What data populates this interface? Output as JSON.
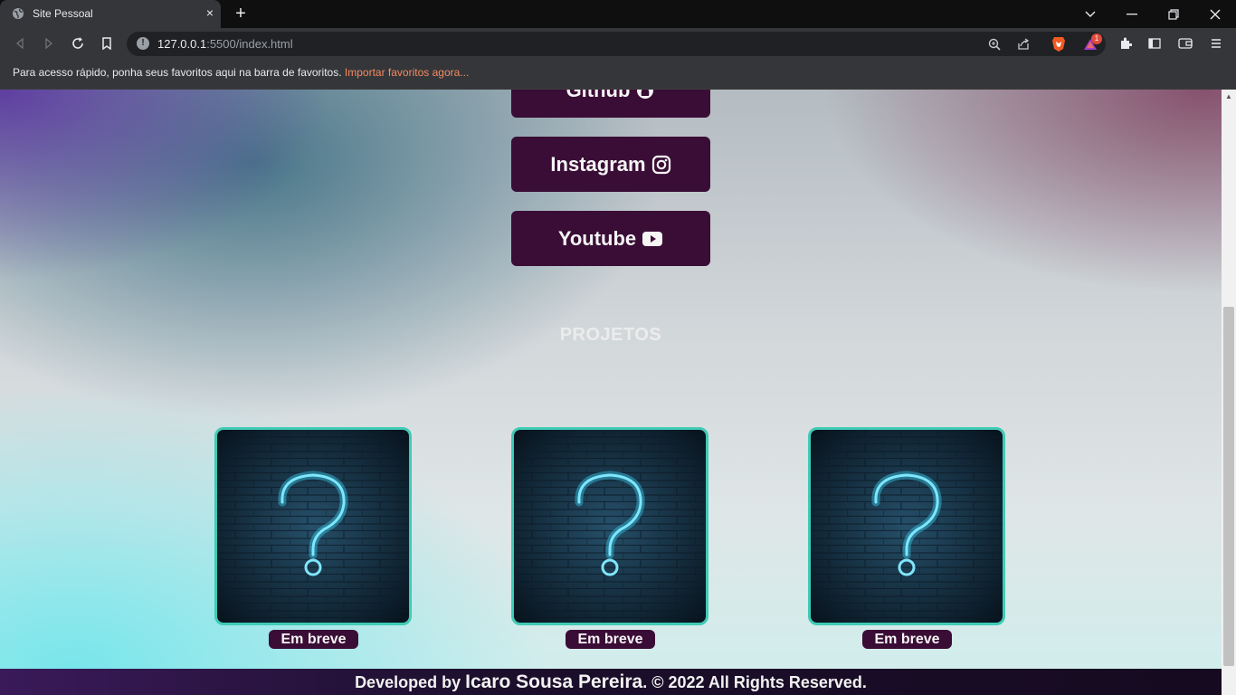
{
  "browser": {
    "tab_title": "Site Pessoal",
    "tab_close": "×",
    "new_tab": "+",
    "url_host": "127.0.0.1",
    "url_path": ":5500/index.html",
    "extension_badge": "1"
  },
  "bookmarks_bar": {
    "message": "Para acesso rápido, ponha seus favoritos aqui na barra de favoritos.",
    "import_link": "Importar favoritos agora..."
  },
  "social_links": [
    {
      "label": "Github",
      "icon": "github-icon"
    },
    {
      "label": "Instagram",
      "icon": "instagram-icon"
    },
    {
      "label": "Youtube",
      "icon": "youtube-icon"
    }
  ],
  "projects": {
    "title": "PROJETOS",
    "items": [
      {
        "label": "Em breve",
        "image": "neon-question-mark"
      },
      {
        "label": "Em breve",
        "image": "neon-question-mark"
      },
      {
        "label": "Em breve",
        "image": "neon-question-mark"
      }
    ]
  },
  "footer": {
    "prefix": "Developed by ",
    "name": "Icaro Sousa Pereira",
    "suffix": ". © 2022 All Rights Reserved."
  },
  "colors": {
    "button_bg": "#3a0d36",
    "card_border": "#3fcbb5",
    "neon": "#38c8e8"
  }
}
